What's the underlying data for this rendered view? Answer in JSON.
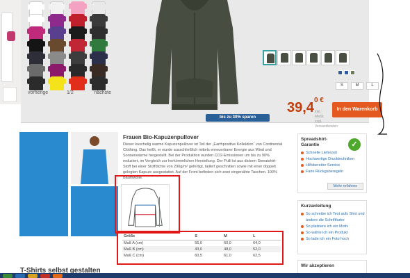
{
  "product": {
    "pager": {
      "prev_label": "vorherige",
      "page": "1/2",
      "next_label": "nächste"
    },
    "colors": [
      "#ffffff",
      "#f2f2f2",
      "#f3a2c2",
      "#e9e9e9",
      "#ffffff",
      "#8e2a8c",
      "#c01f2c",
      "#3a3a3a",
      "#c02a7a",
      "#5a3f8e",
      "#1b1b1b",
      "#2e2e2e",
      "#151515",
      "#6a4a2e",
      "#c02633",
      "#2f7a3c",
      "#2e2e38",
      "#8a8a8a",
      "#3d3d3d",
      "#2c2f4a",
      "#6b6b6b",
      "#8b1a6a",
      "#2a2a2a",
      "#3a2a24",
      "#2b2b2b",
      "#f4e21a",
      "#e02e1a",
      "#2c2c2c"
    ],
    "thumb_count": 6,
    "swatch_colors": [
      "#2a5a9a",
      "#2e5aa0",
      "#6b7a5a"
    ],
    "sizes": [
      "S",
      "M",
      "L"
    ],
    "discount_label": "bis zu 30% sparen",
    "price_main": "39,4",
    "price_sup": "0 €",
    "price_info": "inkl. MwSt. zzgl. Versandkosten",
    "cart_label": "In den Warenkorb"
  },
  "description": {
    "title": "Frauen Bio-Kapuzenpullover",
    "text": "Dieser kuschelig warme Kapuzenpullover ist Teil der „Earthpositive Kollektion“ von Continental Clothing. Das heißt, er wurde ausschließlich mittels erneuerbarer Energie aus Wind und Sonnenwärme hergestellt. Bei der Produktion wurden CO2-Emissionen um bis zu 90% reduziert, im Vergleich zur herkömmlichen Herstellung. Der Pulli ist aus dickem Sweatshirt-Stoff bei einer Stoffdichte von 290g/m² gefertigt, taillert geschnitten sowie mit einer doppelt gelegten Kapuze ausgestattet. Auf der Front befinden sich zwei eingenähte Taschen. 100% Baumwolle."
  },
  "size_table": {
    "headers": [
      "Größe",
      "S",
      "M",
      "L"
    ],
    "rows": [
      [
        "Maß A (cm)",
        "56,0",
        "60,0",
        "64,0"
      ],
      [
        "Maß B (cm)",
        "43,0",
        "48,0",
        "52,0"
      ],
      [
        "Maß C (cm)",
        "60,5",
        "61,0",
        "62,5"
      ]
    ]
  },
  "section_heading": "T-Shirts selbst gestalten",
  "guarantee": {
    "title": "Spreadshirt-Garantie",
    "items": [
      "Schnelle Lieferzeit",
      "Hochwertige Drucktechniken",
      "Hilfsbereiter Service",
      "Faire Rückgaberegeln"
    ],
    "more_label": "Mehr erfahren"
  },
  "guide": {
    "title": "Kurzanleitung",
    "items": [
      "So schreibe ich Text aufs Shirt und ändere die Schriftfarbe",
      "So platziere ich ein Motiv",
      "So wähle ich ein Produkt",
      "So lade ich ein Foto hoch"
    ]
  },
  "payments": {
    "title": "Wir akzeptieren"
  }
}
